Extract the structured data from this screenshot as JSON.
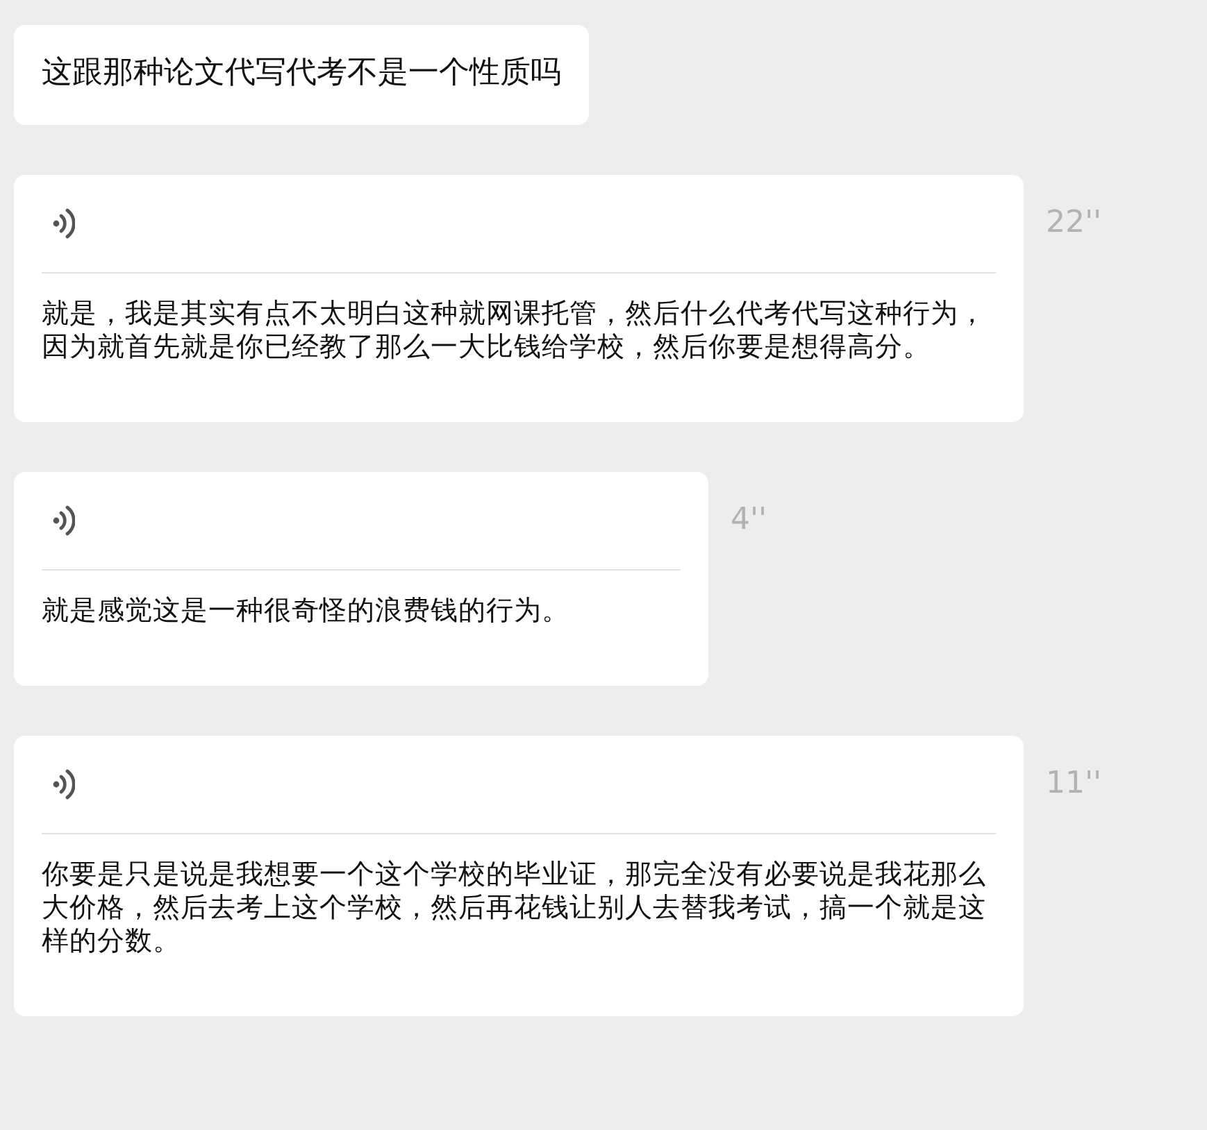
{
  "messages": [
    {
      "kind": "text",
      "text": "这跟那种论文代写代考不是一个性质吗"
    },
    {
      "kind": "voice",
      "duration": "22''",
      "transcript": "就是，我是其实有点不太明白这种就网课托管，然后什么代考代写这种行为，因为就首先就是你已经教了那么一大比钱给学校，然后你要是想得高分。"
    },
    {
      "kind": "voice",
      "duration": "4''",
      "transcript": "就是感觉这是一种很奇怪的浪费钱的行为。"
    },
    {
      "kind": "voice",
      "duration": "11''",
      "transcript": "你要是只是说是我想要一个这个学校的毕业证，那完全没有必要说是我花那么大价格，然后去考上这个学校，然后再花钱让别人去替我考试，搞一个就是这样的分数。"
    }
  ]
}
